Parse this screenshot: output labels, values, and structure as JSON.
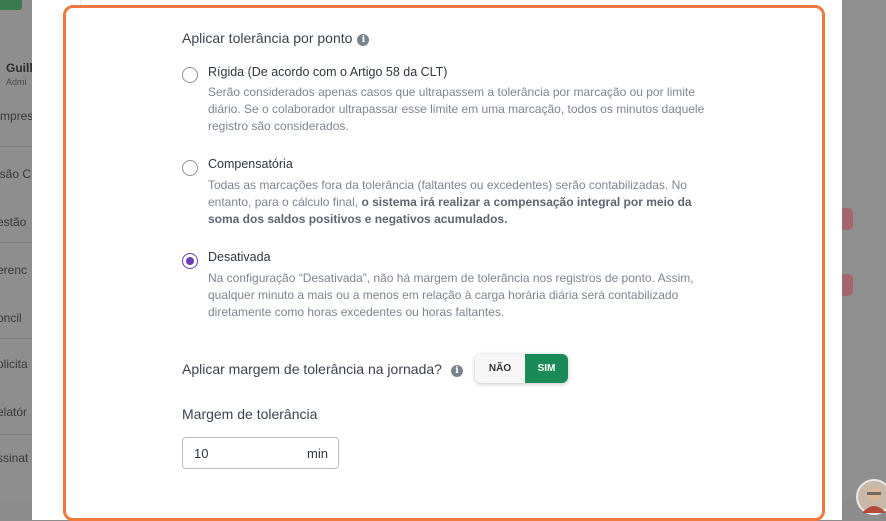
{
  "background": {
    "user_name": "Guilh",
    "user_role": "Admi",
    "sidebar_fragments": [
      "mpresa",
      "isão C",
      "estão",
      "erenc",
      "oncil",
      "olicita",
      "elatór",
      "ssinat"
    ]
  },
  "tolerance_section": {
    "title": "Aplicar tolerância por ponto",
    "info_icon": "info-icon",
    "options": [
      {
        "label": "Rígida (De acordo com o Artigo 58 da CLT)",
        "description": "Serão considerados apenas casos que ultrapassem a tolerância por marcação ou por limite diário. Se o colaborador ultrapassar esse limite em uma marcação, todos os minutos daquele registro são considerados.",
        "selected": false
      },
      {
        "label": "Compensatória",
        "description_pre": "Todas as marcações fora da tolerância (faltantes ou excedentes) serão contabilizadas. No entanto, para o cálculo final, ",
        "description_bold": "o sistema irá realizar a compensação integral por meio da soma dos saldos positivos e negativos acumulados.",
        "selected": false
      },
      {
        "label": "Desativada",
        "description": "Na configuração “Desativada”, não há margem de tolerância nos registros de ponto. Assim, qualquer minuto a mais ou a menos em relação à carga horária diária será contabilizado diretamente como horas excedentes ou horas faltantes.",
        "selected": true
      }
    ]
  },
  "journey_margin": {
    "question": "Aplicar margem de tolerância na jornada?",
    "toggle_no": "NÃO",
    "toggle_yes": "SIM",
    "selected": "SIM"
  },
  "margin_field": {
    "label": "Margem de tolerância",
    "value": "10",
    "unit": "min"
  },
  "colors": {
    "accent_border": "#f0793f",
    "radio_selected": "#6a3fb5",
    "toggle_active": "#1a8a58"
  }
}
